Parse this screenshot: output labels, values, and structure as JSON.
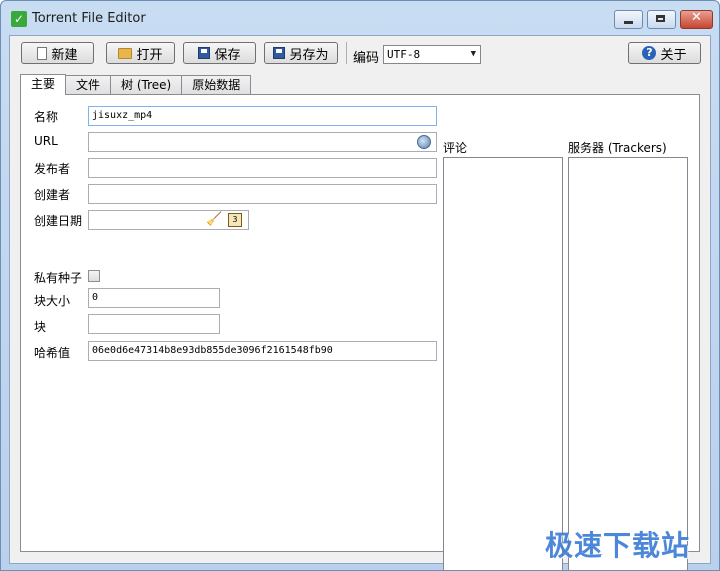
{
  "window": {
    "title": "Torrent File Editor"
  },
  "toolbar": {
    "new_label": "新建",
    "open_label": "打开",
    "save_label": "保存",
    "saveas_label": "另存为",
    "encoding_label": "编码",
    "encoding_value": "UTF-8",
    "about_label": "关于"
  },
  "tabs": [
    {
      "label": "主要"
    },
    {
      "label": "文件"
    },
    {
      "label": "树 (Tree)"
    },
    {
      "label": "原始数据"
    }
  ],
  "form": {
    "name_label": "名称",
    "name_value": "jisuxz_mp4",
    "url_label": "URL",
    "url_value": "",
    "publisher_label": "发布者",
    "publisher_value": "",
    "creator_label": "创建者",
    "creator_value": "",
    "date_label": "创建日期",
    "date_value": "",
    "private_label": "私有种子",
    "piece_size_label": "块大小",
    "piece_size_value": "0",
    "pieces_label": "块",
    "pieces_value": "",
    "hash_label": "哈希值",
    "hash_value": "06e0d6e47314b8e93db855de3096f2161548fb90"
  },
  "comment_label": "评论",
  "trackers_label": "服务器 (Trackers)",
  "watermark": "极速下载站"
}
